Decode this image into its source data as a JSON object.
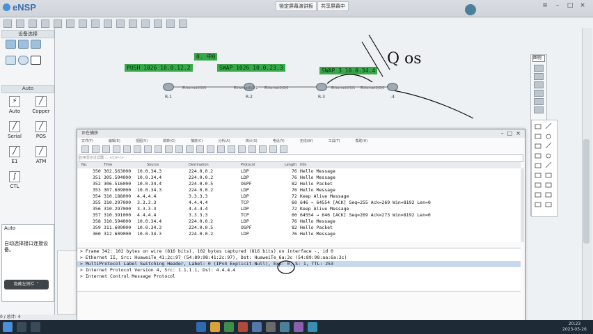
{
  "app": {
    "title": "eNSP"
  },
  "meeting": {
    "btn1": "锁定屏幕演讲板",
    "btn2": "共享屏幕中"
  },
  "left_panel": {
    "device_header": "设备选择",
    "cable_header": "Auto",
    "cables": [
      "Auto",
      "Copper",
      "Serial",
      "POS",
      "E1",
      "ATM",
      "CTL"
    ],
    "auto_title": "Auto",
    "auto_desc": "自动选择接口连接设备。",
    "dark_button": "隐藏左侧栏 ⌃"
  },
  "topology": {
    "label_top": "0. 中0",
    "push": "PUSH 1026 10.0.12.2",
    "swap1": "SWAP 1026 10.0.23.3",
    "swap2": "SWAP 3 10.0.34.4",
    "handwriting": "Q os",
    "routers": [
      "R-1",
      "R-2",
      "R-3",
      "-4"
    ],
    "ports": [
      "Ethernet0/0/0",
      "Ethernet0/0/1",
      "Ethernet0/0/0",
      "Ethernet0/0/1",
      "Ethernet0/0/0"
    ]
  },
  "right_panel": {
    "title": "图例"
  },
  "wireshark": {
    "title": "正在捕获",
    "menu": [
      "文件(F)",
      "编辑(E)",
      "视图(V)",
      "跳转(G)",
      "捕获(C)",
      "分析(A)",
      "统计(S)",
      "电话(Y)",
      "无线(W)",
      "工具(T)",
      "帮助(H)"
    ],
    "filter_placeholder": "应用显示过滤器 … <Ctrl-/>",
    "columns": [
      "No.",
      "Time",
      "Source",
      "Destination",
      "Protocol",
      "Length",
      "Info"
    ],
    "rows": [
      {
        "no": "350",
        "time": "302.563000",
        "src": "10.0.34.3",
        "dst": "224.0.0.2",
        "proto": "LDP",
        "len": "76",
        "info": "Hello Message"
      },
      {
        "no": "351",
        "time": "305.594000",
        "src": "10.0.34.4",
        "dst": "224.0.0.2",
        "proto": "LDP",
        "len": "76",
        "info": "Hello Message"
      },
      {
        "no": "352",
        "time": "306.516000",
        "src": "10.0.34.4",
        "dst": "224.0.0.5",
        "proto": "OSPF",
        "len": "82",
        "info": "Hello Packet"
      },
      {
        "no": "353",
        "time": "307.609000",
        "src": "10.0.34.3",
        "dst": "224.0.0.2",
        "proto": "LDP",
        "len": "76",
        "info": "Hello Message"
      },
      {
        "no": "354",
        "time": "310.188000",
        "src": "4.4.4.4",
        "dst": "3.3.3.3",
        "proto": "LDP",
        "len": "72",
        "info": "Keep Alive Message"
      },
      {
        "no": "355",
        "time": "310.297000",
        "src": "3.3.3.3",
        "dst": "4.4.4.4",
        "proto": "TCP",
        "len": "60",
        "info": "646 → 64554 [ACK] Seq=255 Ack=269 Win=8192 Len=0"
      },
      {
        "no": "356",
        "time": "310.297000",
        "src": "3.3.3.3",
        "dst": "4.4.4.4",
        "proto": "LDP",
        "len": "72",
        "info": "Keep Alive Message"
      },
      {
        "no": "357",
        "time": "310.391000",
        "src": "4.4.4.4",
        "dst": "3.3.3.3",
        "proto": "TCP",
        "len": "60",
        "info": "64554 → 646 [ACK] Seq=269 Ack=273 Win=8192 Len=0"
      },
      {
        "no": "358",
        "time": "310.594000",
        "src": "10.0.34.4",
        "dst": "224.0.0.2",
        "proto": "LDP",
        "len": "76",
        "info": "Hello Message"
      },
      {
        "no": "359",
        "time": "311.609000",
        "src": "10.0.34.3",
        "dst": "224.0.0.5",
        "proto": "OSPF",
        "len": "82",
        "info": "Hello Packet"
      },
      {
        "no": "360",
        "time": "312.609000",
        "src": "10.0.34.3",
        "dst": "224.0.0.2",
        "proto": "LDP",
        "len": "76",
        "info": "Hello Message"
      }
    ],
    "details": [
      "Frame 342: 102 bytes on wire (816 bits), 102 bytes captured (816 bits) on interface -, id 0",
      "Ethernet II, Src: HuaweiTe_41:2c:97 (54:89:98:41:2c:97), Dst: HuaweiTe_6a:3c (54:89:98:aa:6a:3c)",
      "MultiProtocol Label Switching Header, Label: 0 (IPv4 Explicit-Null), Exp: 0, S: 1, TTL: 253",
      "Internet Protocol Version 4, Src: 1.1.1.1, Dst: 4.4.4.4",
      "Internet Control Message Protocol"
    ]
  },
  "statusbar": {
    "text": "0 / 总计: 4"
  },
  "taskbar": {
    "time": "20:23",
    "date": "2023-05-26"
  }
}
